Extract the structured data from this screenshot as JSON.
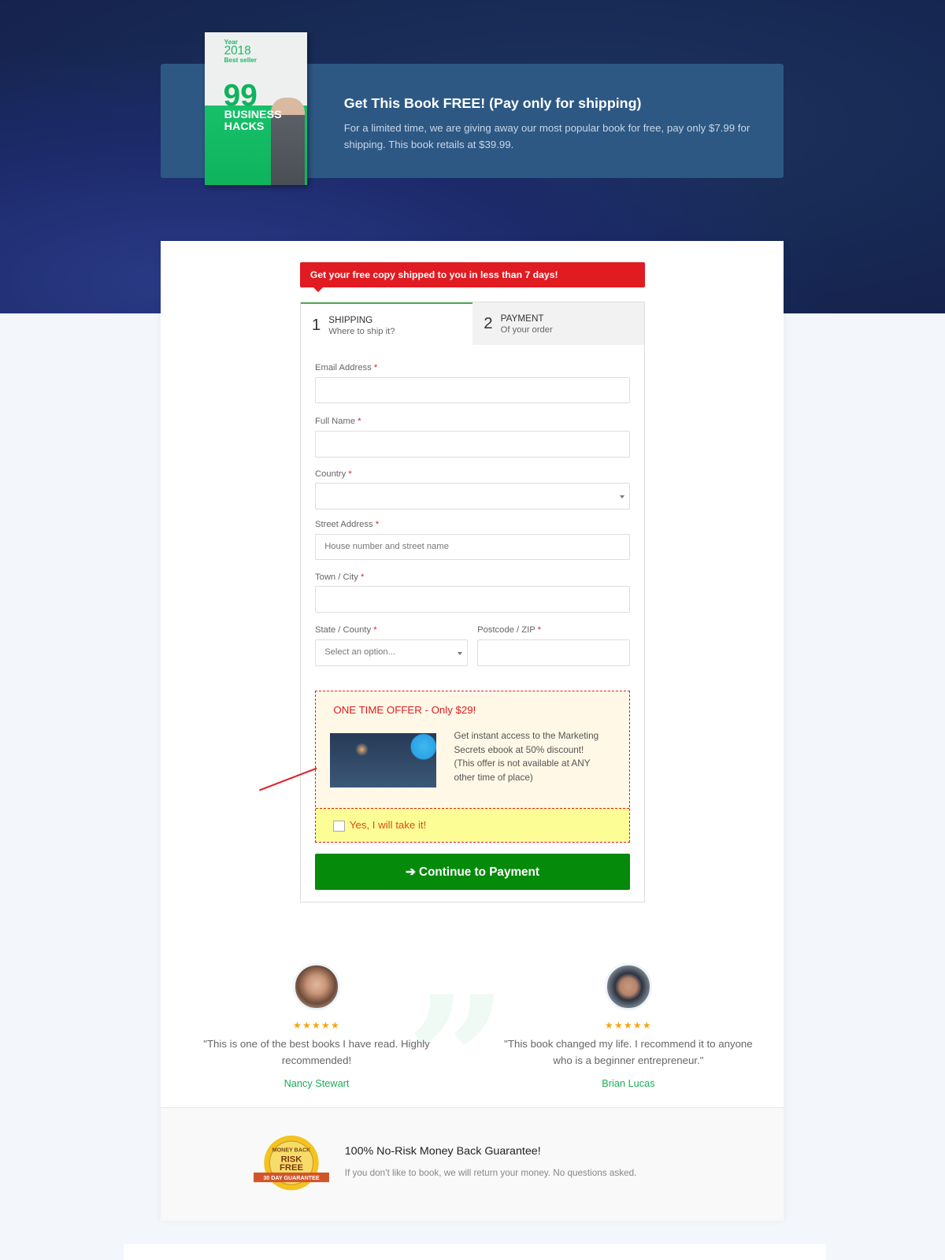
{
  "hero": {
    "title": "Get This Book FREE! (Pay only for shipping)",
    "description": "For a limited time, we are giving away our most popular book for free, pay only $7.99 for shipping. This book retails at $39.99.",
    "book_cover": {
      "year_label": "Year",
      "year": "2018",
      "badge": "Best seller",
      "number": "99",
      "title": "BUSINESS HACKS"
    }
  },
  "notice": "Get your free copy shipped to you in less than 7 days!",
  "steps": [
    {
      "number": "1",
      "title": "SHIPPING",
      "subtitle": "Where to ship it?",
      "active": true
    },
    {
      "number": "2",
      "title": "PAYMENT",
      "subtitle": "Of your order",
      "active": false
    }
  ],
  "form": {
    "required_mark": "*",
    "email": {
      "label": "Email Address",
      "value": ""
    },
    "full_name": {
      "label": "Full Name",
      "value": ""
    },
    "country": {
      "label": "Country",
      "value": ""
    },
    "street": {
      "label": "Street Address",
      "placeholder": "House number and street name"
    },
    "city": {
      "label": "Town / City",
      "value": ""
    },
    "state": {
      "label": "State / County",
      "placeholder": "Select an option..."
    },
    "postcode": {
      "label": "Postcode / ZIP",
      "value": ""
    }
  },
  "offer": {
    "title": "ONE TIME OFFER - Only $29!",
    "description": "Get instant access to the Marketing Secrets ebook at 50% discount! (This offer is not available at ANY other time of place)",
    "checkbox_label": "Yes, I will take it!",
    "checked": false
  },
  "continue_button": "Continue to Payment",
  "testimonials": [
    {
      "rating": 5,
      "stars": "★★★★★",
      "quote": "\"This is one of the best books I have read. Highly recommended!",
      "name": "Nancy Stewart"
    },
    {
      "rating": 5,
      "stars": "★★★★★",
      "quote": "\"This book changed my life. I recommend it to anyone who is a beginner entrepreneur.\"",
      "name": "Brian Lucas"
    }
  ],
  "guarantee": {
    "title": "100% No-Risk Money Back Guarantee!",
    "text": "If you don't like to book, we will return your money. No questions asked.",
    "seal": {
      "top": "MONEY BACK",
      "middle": "RISK FREE",
      "ribbon": "30 DAY GUARANTEE"
    }
  },
  "colors": {
    "accent_red": "#e11b22",
    "button_green": "#058a0a",
    "name_green": "#1faa56",
    "banner_blue": "#2d5884",
    "star": "#f5a70a"
  }
}
